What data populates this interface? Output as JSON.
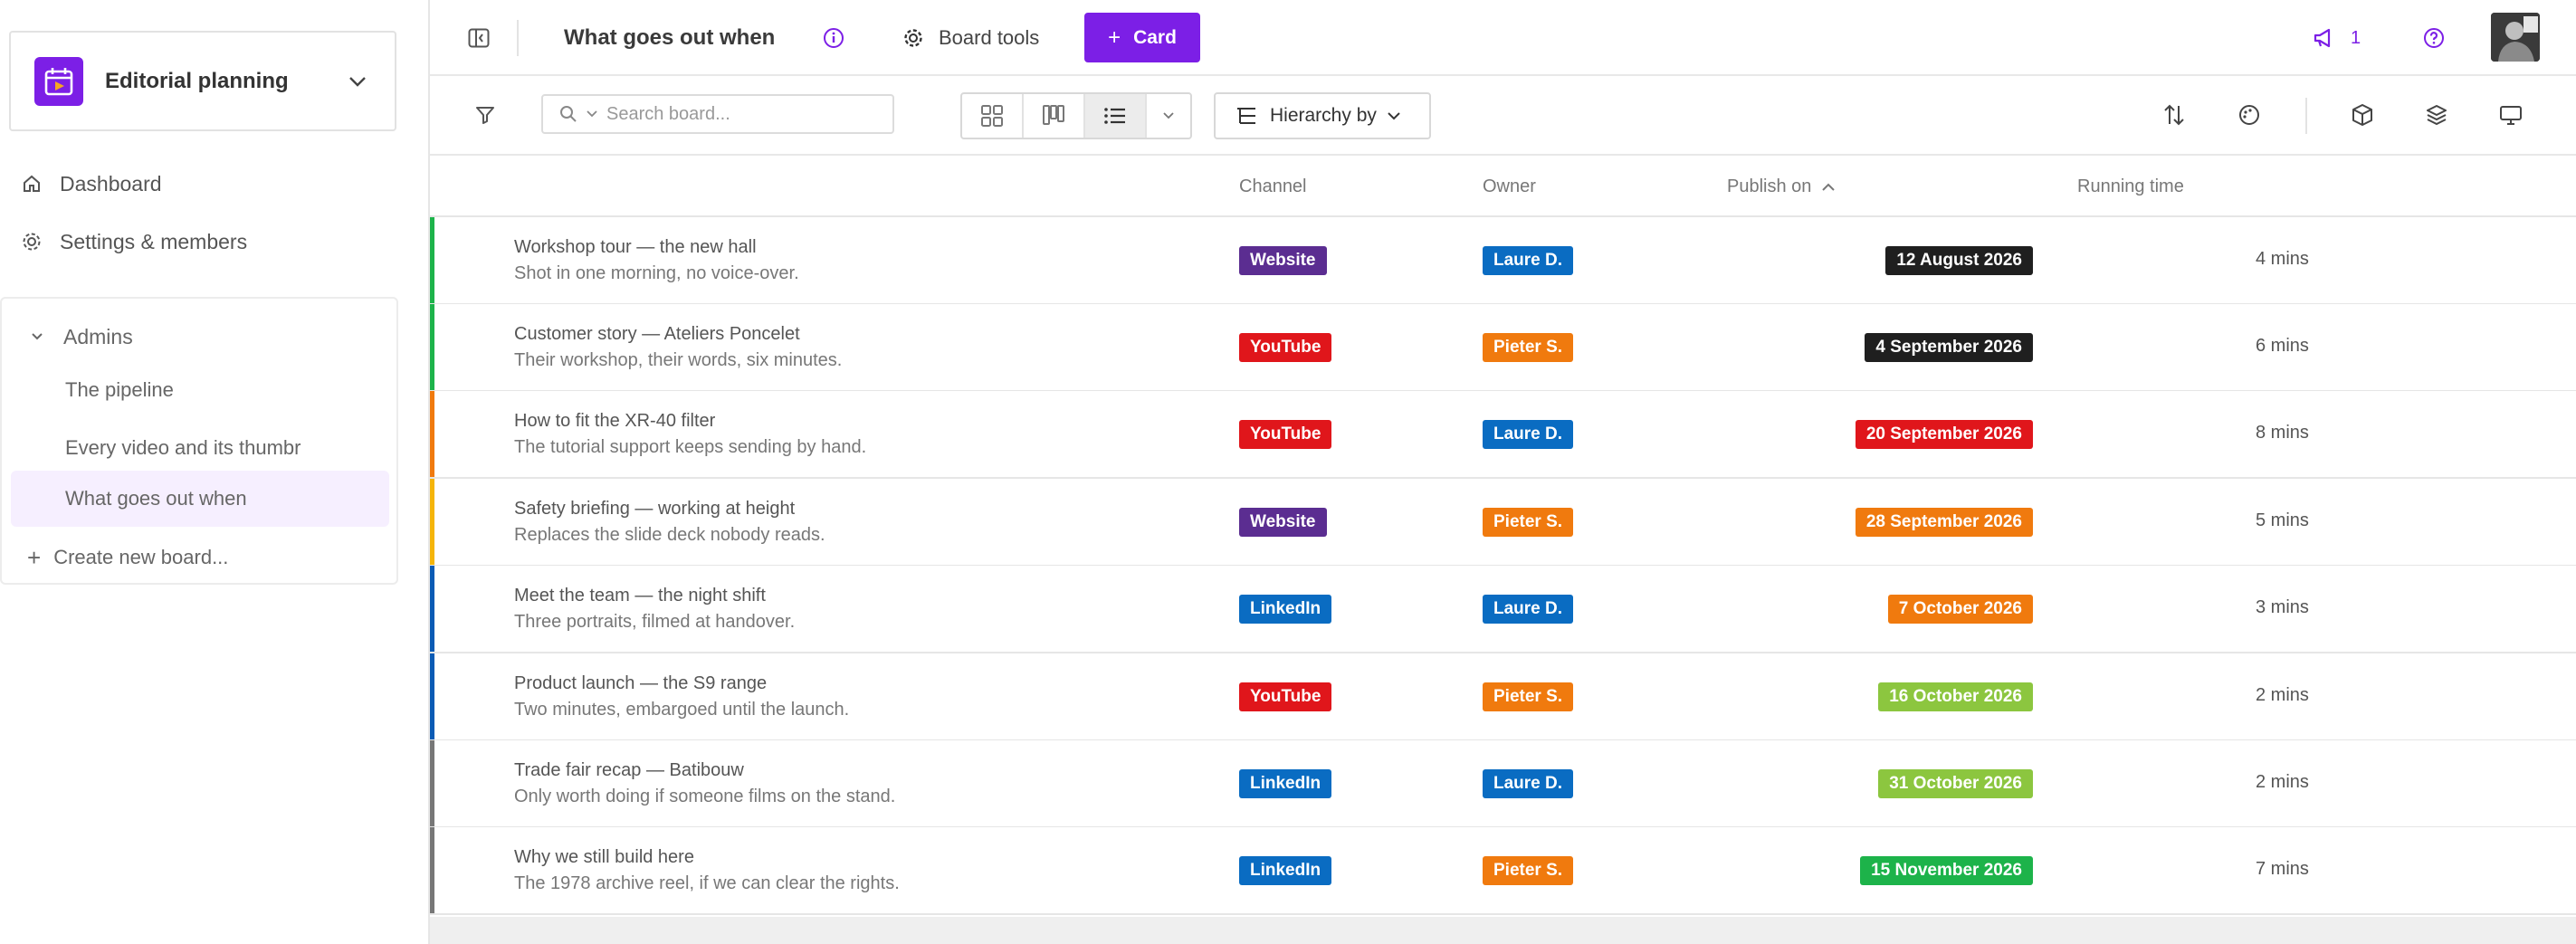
{
  "workspace": {
    "name": "Editorial planning"
  },
  "sidebar": {
    "nav": [
      {
        "label": "Dashboard",
        "icon": "home-icon"
      },
      {
        "label": "Settings & members",
        "icon": "gear-icon"
      }
    ],
    "group": {
      "label": "Admins",
      "items": [
        {
          "label": "The pipeline"
        },
        {
          "label": "Every video and its thumbr"
        },
        {
          "label": "What goes out when"
        }
      ],
      "create_label": "Create new board..."
    }
  },
  "topbar": {
    "title": "What goes out when",
    "board_tools_label": "Board tools",
    "card_button_label": "Card",
    "notification_count": "1"
  },
  "toolbar": {
    "search_placeholder": "Search board...",
    "hierarchy_label": "Hierarchy by"
  },
  "table": {
    "columns": {
      "channel": "Channel",
      "owner": "Owner",
      "publish_on": "Publish on",
      "running_time": "Running time"
    },
    "rows": [
      {
        "title": "Workshop tour — the new hall",
        "subtitle": "Shot in one morning, no voice-over.",
        "channel": "Website",
        "owner": "Laure D.",
        "date": "12 August 2026",
        "running": "4 mins",
        "bar": "#1db34a",
        "channel_color": "#5b2d91",
        "owner_color": "#0a6cc2",
        "date_color": "#1f1f1f"
      },
      {
        "title": "Customer story — Ateliers Poncelet",
        "subtitle": "Their workshop, their words, six minutes.",
        "channel": "YouTube",
        "owner": "Pieter S.",
        "date": "4 September 2026",
        "running": "6 mins",
        "bar": "#1db34a",
        "channel_color": "#e0161b",
        "owner_color": "#f07a0e",
        "date_color": "#1f1f1f"
      },
      {
        "title": "How to fit the XR-40 filter",
        "subtitle": "The tutorial support keeps sending by hand.",
        "channel": "YouTube",
        "owner": "Laure D.",
        "date": "20 September 2026",
        "running": "8 mins",
        "bar": "#f07a0e",
        "channel_color": "#e0161b",
        "owner_color": "#0a6cc2",
        "date_color": "#e0161b"
      },
      {
        "title": "Safety briefing — working at height",
        "subtitle": "Replaces the slide deck nobody reads.",
        "channel": "Website",
        "owner": "Pieter S.",
        "date": "28 September 2026",
        "running": "5 mins",
        "bar": "#f5b50a",
        "channel_color": "#5b2d91",
        "owner_color": "#f07a0e",
        "date_color": "#f07a0e"
      },
      {
        "title": "Meet the team — the night shift",
        "subtitle": "Three portraits, filmed at handover.",
        "channel": "LinkedIn",
        "owner": "Laure D.",
        "date": "7 October 2026",
        "running": "3 mins",
        "bar": "#0a5bb5",
        "channel_color": "#0a6cc2",
        "owner_color": "#0a6cc2",
        "date_color": "#f07a0e"
      },
      {
        "title": "Product launch — the S9 range",
        "subtitle": "Two minutes, embargoed until the launch.",
        "channel": "YouTube",
        "owner": "Pieter S.",
        "date": "16 October 2026",
        "running": "2 mins",
        "bar": "#0a5bb5",
        "channel_color": "#e0161b",
        "owner_color": "#f07a0e",
        "date_color": "#8cc63f"
      },
      {
        "title": "Trade fair recap — Batibouw",
        "subtitle": "Only worth doing if someone films on the stand.",
        "channel": "LinkedIn",
        "owner": "Laure D.",
        "date": "31 October 2026",
        "running": "2 mins",
        "bar": "#777777",
        "channel_color": "#0a6cc2",
        "owner_color": "#0a6cc2",
        "date_color": "#8cc63f"
      },
      {
        "title": "Why we still build here",
        "subtitle": "The 1978 archive reel, if we can clear the rights.",
        "channel": "LinkedIn",
        "owner": "Pieter S.",
        "date": "15 November 2026",
        "running": "7 mins",
        "bar": "#777777",
        "channel_color": "#0a6cc2",
        "owner_color": "#f07a0e",
        "date_color": "#1db34a"
      }
    ]
  },
  "colors": {
    "accent": "#7c1fe6"
  }
}
